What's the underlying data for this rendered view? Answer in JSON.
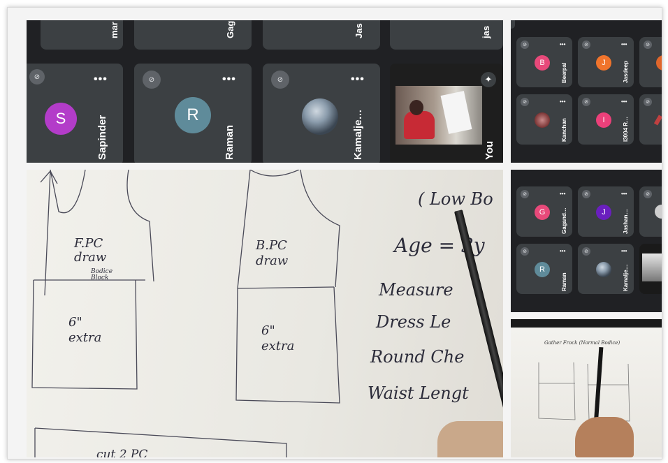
{
  "top_row_names": [
    "mar",
    "Gag",
    "Jas",
    "jas"
  ],
  "participants": [
    {
      "name": "Sapinder",
      "initial": "S",
      "color": "#b33cc9"
    },
    {
      "name": "Raman",
      "initial": "R",
      "color": "#5f8b9a"
    },
    {
      "name": "Kamalje…",
      "initial": "",
      "color": "#6b7c8c"
    },
    {
      "name": "You",
      "initial": "",
      "color": ""
    }
  ],
  "right_grid_top": [
    {
      "name": "Beerpal",
      "initial": "B",
      "color": "#e8497a"
    },
    {
      "name": "Jasdeep",
      "initial": "J",
      "color": "#f0742c"
    },
    {
      "name": "Kanchan",
      "initial": "",
      "color": "#a04a4a"
    },
    {
      "name": "I3004 R…",
      "initial": "I",
      "color": "#ec407a"
    }
  ],
  "right_grid_mid": [
    {
      "name": "Gagand…",
      "initial": "G",
      "color": "#e8497a"
    },
    {
      "name": "Jashan…",
      "initial": "J",
      "color": "#6a1fbf"
    },
    {
      "name": "Raman",
      "initial": "R",
      "color": "#5f8b9a"
    },
    {
      "name": "Kamalje…",
      "initial": "",
      "color": "#6b7c8c"
    }
  ],
  "drawing": {
    "front": "F.PC\ndraw",
    "bodice": "Bodice\nBlock",
    "front_extra": "6\"\nextra",
    "back": "B.PC\ndraw",
    "back_extra": "6\"\nextra",
    "cut": "cut 2 PC",
    "low": "( Low Bo",
    "age": "Age = 3y",
    "measure": "Measure",
    "dress": "Dress Le",
    "round": "Round Che",
    "waist": "Waist Lengt"
  },
  "thumbnail_title": "Gather Frock (Normal Bodice)",
  "icons": [
    "mic-off-icon",
    "more-options-icon",
    "sparkle-icon",
    "pencil-icon"
  ]
}
